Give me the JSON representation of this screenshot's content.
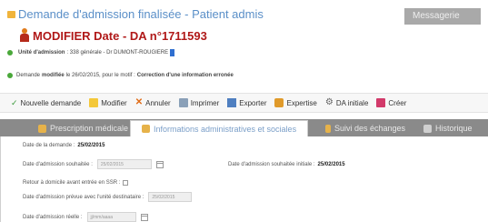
{
  "header": {
    "title": "Demande d'admission finalisée - Patient admis",
    "subtitle": "MODIFIER Date - DA n°1711593",
    "messages_label": "Messagerie",
    "unit_label": "Unité d'admission",
    "unit_value": ": 338 générale - Dr DUMONT-ROUGIERE",
    "modified_prefix": "Demande",
    "modified_word": "modifiée",
    "modified_middle": "le 26/02/2015, pour le motif :",
    "modified_reason": "Correction d'une information erronée",
    "colors": {
      "title": "#5a8fc8",
      "subtitle": "#b01818",
      "status_dot": "#4aa83a"
    }
  },
  "toolbar": {
    "items": [
      {
        "label": "Nouvelle demande",
        "icon": "check-icon"
      },
      {
        "label": "Modifier",
        "icon": "edit-icon"
      },
      {
        "label": "Annuler",
        "icon": "cancel-icon"
      },
      {
        "label": "Imprimer",
        "icon": "printer-icon"
      },
      {
        "label": "Exporter",
        "icon": "export-icon"
      },
      {
        "label": "Expertise",
        "icon": "expert-icon"
      },
      {
        "label": "DA initiale",
        "icon": "gear-icon"
      },
      {
        "label": "Créer",
        "icon": "create-icon"
      }
    ]
  },
  "tabs": [
    {
      "label": "Prescription médicale",
      "active": false
    },
    {
      "label": "Informations administratives et sociales",
      "active": true
    },
    {
      "label": "Suivi des échanges",
      "active": false
    },
    {
      "label": "Historique",
      "active": false
    }
  ],
  "form": {
    "date_demande_label": "Date de la demande :",
    "date_demande_value": "25/02/2015",
    "date_souhaitee_label": "Date d'admission souhaitée :",
    "date_souhaitee_value": "25/02/2015",
    "date_initiale_label": "Date d'admission souhaitée initiale :",
    "date_initiale_value": "25/02/2015",
    "retour_label": "Retour à domicile avant entrée en SSR :",
    "date_prevue_label": "Date d'admission prévue avec l'unité destinataire :",
    "date_prevue_value": "25/02/2015",
    "date_reelle_label": "Date d'admission réelle :",
    "date_reelle_value": "jj/mm/aaaa"
  }
}
